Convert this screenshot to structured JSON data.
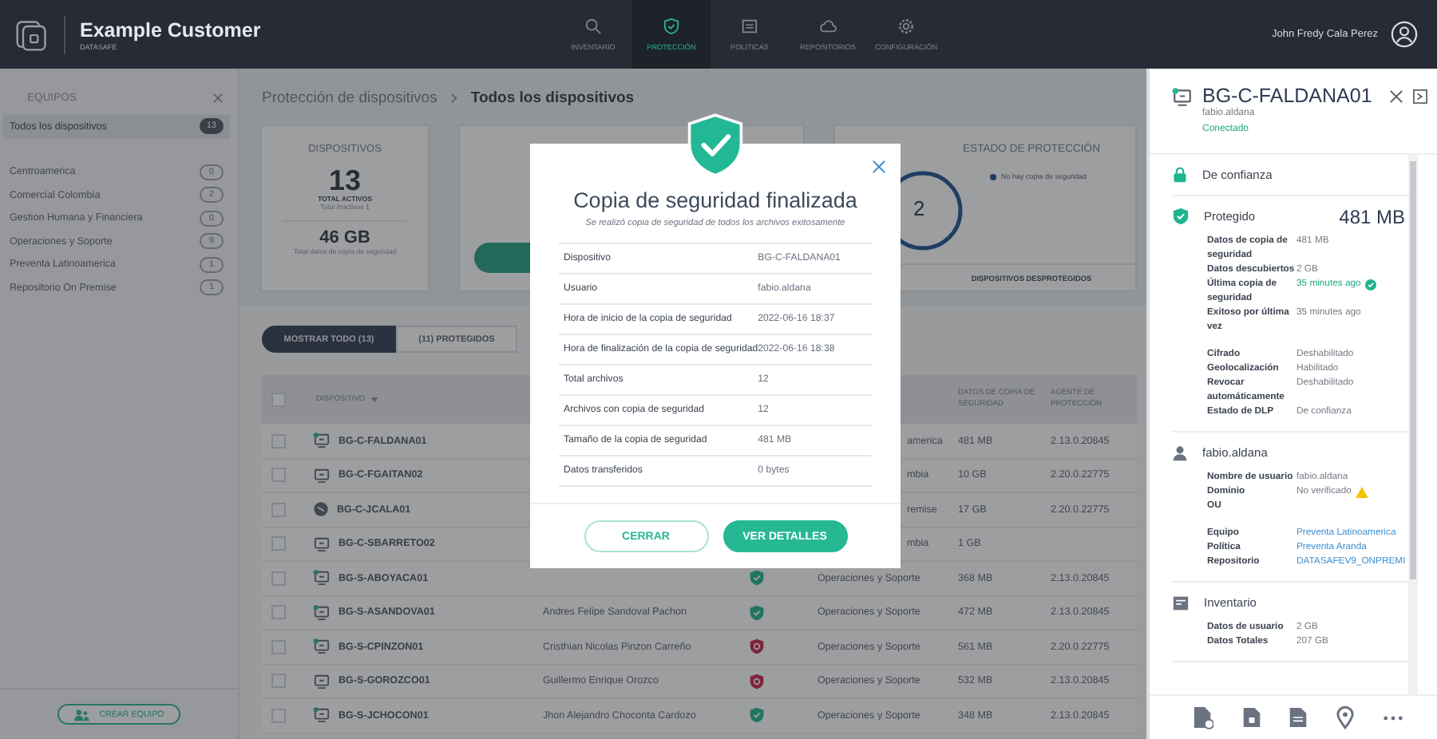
{
  "header": {
    "title": "Example Customer",
    "subtitle": "DATASAFE",
    "user": "John Fredy Cala Perez",
    "nav": [
      {
        "label": "INVENTARIO",
        "selected": false
      },
      {
        "label": "PROTECCIÓN",
        "selected": true
      },
      {
        "label": "POLÍTICAS",
        "selected": false
      },
      {
        "label": "REPOSITORIOS",
        "selected": false
      },
      {
        "label": "CONFIGURACIÓN",
        "selected": false
      }
    ]
  },
  "sidebar": {
    "title": "EQUIPOS",
    "button": "CREAR EQUIPO",
    "items": [
      {
        "label": "Todos los dispositivos",
        "count": "13",
        "selected": true
      },
      {
        "label": "Centroamerica",
        "count": "0",
        "selected": false
      },
      {
        "label": "Comercial Colombia",
        "count": "2",
        "selected": false
      },
      {
        "label": "Gestion Humana y Financiera",
        "count": "0",
        "selected": false
      },
      {
        "label": "Operaciones y Soporte",
        "count": "9",
        "selected": false
      },
      {
        "label": "Preventa Latinoamerica",
        "count": "1",
        "selected": false
      },
      {
        "label": "Repositorio On Premise",
        "count": "1",
        "selected": false
      }
    ]
  },
  "breadcrumb": [
    "Protección de dispositivos",
    "Todos los dispositivos"
  ],
  "devices_card": {
    "title": "DISPOSITIVOS",
    "total": "13",
    "total_label": "TOTAL ACTIVOS",
    "inactive": "Total Inactivos 1",
    "data": "46 GB",
    "data_label": "Total datos de copia de seguridad"
  },
  "protection_card": {
    "title": "ESTADO DE PROTECCIÓN",
    "count": "2",
    "footer": "DISPOSITIVOS DESPROTEGIDOS",
    "legend": [
      {
        "label": "No hay copia de seguridad"
      }
    ]
  },
  "tabs": [
    {
      "label": "MOSTRAR TODO (13)",
      "selected": true
    },
    {
      "label": "(11) PROTEGIDOS",
      "selected": false
    }
  ],
  "table": {
    "all_checked": false,
    "columns": {
      "device": "DISPOSITIVO",
      "backup": "DATOS DE COPIA DE SEGURIDAD",
      "agent": "AGENTE DE PROTECCIÓN"
    },
    "rows": [
      {
        "checked": false,
        "device": "BG-C-FALDANA01",
        "kind": "desktop",
        "connected": true,
        "group": "america",
        "group_partial": true,
        "backup": "481 MB",
        "agent": "2.13.0.20845"
      },
      {
        "checked": false,
        "device": "BG-C-FGAITAN02",
        "kind": "desktop",
        "connected": false,
        "group": "mbia",
        "group_partial": true,
        "backup": "10 GB",
        "agent": "2.20.0.22775"
      },
      {
        "checked": false,
        "device": "BG-C-JCALA01",
        "kind": "disc",
        "connected": false,
        "group": "remise",
        "group_partial": true,
        "backup": "17 GB",
        "agent": "2.20.0.22775"
      },
      {
        "checked": false,
        "device": "BG-C-SBARRETO02",
        "kind": "desktop",
        "connected": false,
        "group": "mbia",
        "group_partial": true,
        "backup": "1 GB"
      },
      {
        "checked": false,
        "device": "BG-S-ABOYACA01",
        "kind": "desktop",
        "connected": true,
        "protected": true,
        "group": "Operaciones y Soporte",
        "group_partial": false,
        "backup": "368 MB",
        "agent": "2.13.0.20845"
      },
      {
        "checked": false,
        "device": "BG-S-ASANDOVA01",
        "kind": "desktop",
        "connected": true,
        "user": "Andres Felipe Sandoval Pachon",
        "protected": true,
        "group": "Operaciones y Soporte",
        "group_partial": false,
        "backup": "472 MB",
        "agent": "2.13.0.20845"
      },
      {
        "checked": false,
        "device": "BG-S-CPINZON01",
        "kind": "desktop",
        "connected": true,
        "user": "Cristhian Nicolas Pinzon Carreño",
        "protected": false,
        "group": "Operaciones y Soporte",
        "group_partial": false,
        "backup": "561 MB",
        "agent": "2.20.0.22775"
      },
      {
        "checked": false,
        "device": "BG-S-GOROZCO01",
        "kind": "desktop",
        "connected": false,
        "user": "Guillermo Enrique Orozco",
        "protected": false,
        "group": "Operaciones y Soporte",
        "group_partial": false,
        "backup": "532 MB",
        "agent": "2.13.0.20845"
      },
      {
        "checked": false,
        "device": "BG-S-JCHOCON01",
        "kind": "desktop",
        "connected": true,
        "user": "Jhon Alejandro Choconta Cardozo",
        "protected": true,
        "group": "Operaciones y Soporte",
        "group_partial": false,
        "backup": "348 MB",
        "agent": "2.13.0.20845"
      }
    ]
  },
  "modal": {
    "title": "Copia de seguridad finalizada",
    "subtitle": "Se realizó copia de seguridad de todos los archivos exitosamente",
    "rows": [
      {
        "label": "Dispositivo",
        "value": "BG-C-FALDANA01"
      },
      {
        "label": "Usuario",
        "value": "fabio.aldana"
      },
      {
        "label": "Hora de inicio de la copia de seguridad",
        "value": "2022-06-16 18:37"
      },
      {
        "label": "Hora de finalización de la copia de seguridad",
        "value": "2022-06-16 18:38"
      },
      {
        "label": "Total archivos",
        "value": "12"
      },
      {
        "label": "Archivos con copia de seguridad",
        "value": "12"
      },
      {
        "label": "Tamaño de la copia de seguridad",
        "value": "481 MB"
      },
      {
        "label": "Datos transferidos",
        "value": "0 bytes"
      }
    ],
    "buttons": [
      {
        "label": "CERRAR",
        "kind": "secondary"
      },
      {
        "label": "VER DETALLES",
        "kind": "primary"
      }
    ]
  },
  "panel": {
    "device": "BG-C-FALDANA01",
    "user": "fabio.aldana",
    "status": "Conectado",
    "sections": [
      {
        "kind": "trust",
        "title": "De confianza"
      },
      {
        "kind": "protection",
        "title": "Protegido",
        "size": "481 MB",
        "groups": [
          [
            {
              "label": "Datos de copia de seguridad",
              "value": "481 MB",
              "kind": "text"
            },
            {
              "label": "Datos descubiertos",
              "value": "2 GB",
              "kind": "text"
            },
            {
              "label": "Última copia de seguridad",
              "value": "35 minutes ago",
              "kind": "success"
            },
            {
              "label": "Exitoso por última vez",
              "value": "35 minutes ago",
              "kind": "text"
            }
          ],
          [
            {
              "label": "Cifrado",
              "value": "Deshabilitado",
              "kind": "text"
            },
            {
              "label": "Geolocalización",
              "value": "Habilitado",
              "kind": "text"
            },
            {
              "label": "Revocar automáticamente",
              "value": "Deshabilitado",
              "kind": "text"
            },
            {
              "label": "Estado de DLP",
              "value": "De confianza",
              "kind": "text"
            }
          ]
        ]
      },
      {
        "kind": "user",
        "title": "fabio.aldana",
        "groups": [
          [
            {
              "label": "Nombre de usuario",
              "value": "fabio.aldana",
              "kind": "text"
            },
            {
              "label": "Dominio",
              "value": "No verificado",
              "kind": "warning"
            },
            {
              "label": "OU",
              "kind": "text"
            }
          ],
          [
            {
              "label": "Equipo",
              "value": "Preventa Latinoamerica",
              "kind": "link"
            },
            {
              "label": "Política",
              "value": "Preventa Aranda",
              "kind": "link"
            },
            {
              "label": "Repositorio",
              "value": "DATASAFEV9_ONPREMI",
              "kind": "link"
            }
          ]
        ]
      },
      {
        "kind": "inventory",
        "title": "Inventario",
        "groups": [
          [
            {
              "label": "Datos de usuario",
              "value": "2 GB",
              "kind": "text"
            },
            {
              "label": "Datos Totales",
              "value": "207 GB",
              "kind": "text"
            }
          ]
        ]
      }
    ]
  }
}
